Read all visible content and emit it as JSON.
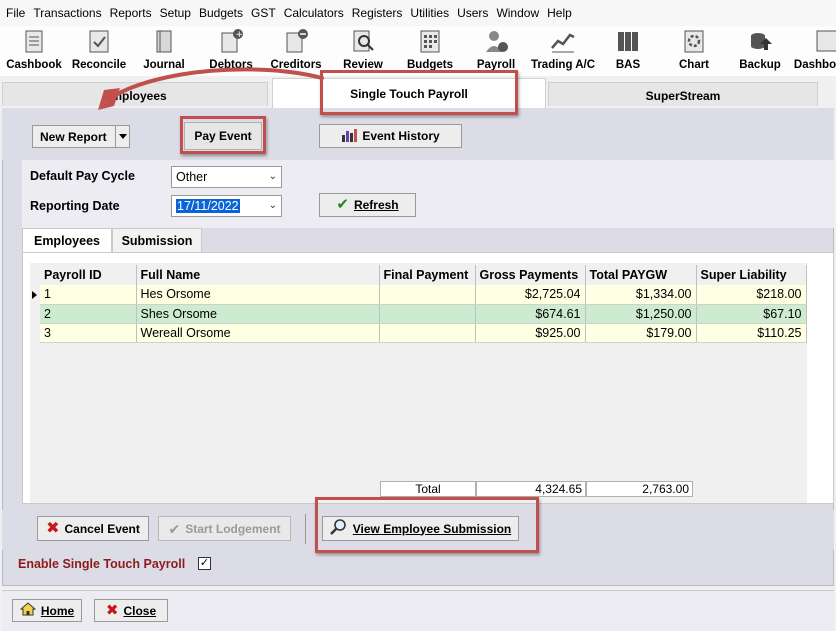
{
  "menu": [
    "File",
    "Transactions",
    "Reports",
    "Setup",
    "Budgets",
    "GST",
    "Calculators",
    "Registers",
    "Utilities",
    "Users",
    "Window",
    "Help"
  ],
  "toolbar": [
    {
      "label": "Cashbook",
      "icon": "cashbook-icon"
    },
    {
      "label": "Reconcile",
      "icon": "reconcile-icon"
    },
    {
      "label": "Journal",
      "icon": "journal-icon"
    },
    {
      "label": "Debtors",
      "icon": "debtors-icon"
    },
    {
      "label": "Creditors",
      "icon": "creditors-icon"
    },
    {
      "label": "Review",
      "icon": "review-icon"
    },
    {
      "label": "Budgets",
      "icon": "budgets-icon"
    },
    {
      "label": "Payroll",
      "icon": "payroll-icon"
    },
    {
      "label": "Trading A/C",
      "icon": "trading-icon"
    },
    {
      "label": "BAS",
      "icon": "bas-icon"
    },
    {
      "label": "Chart",
      "icon": "chart-icon"
    },
    {
      "label": "Backup",
      "icon": "backup-icon"
    },
    {
      "label": "Dashbo",
      "icon": "dashboard-icon"
    }
  ],
  "top_tabs": [
    {
      "label": "Employees"
    },
    {
      "label": "Single Touch Payroll"
    },
    {
      "label": "SuperStream"
    }
  ],
  "actions": {
    "new_report": "New Report",
    "pay_event": "Pay Event",
    "event_history": "Event History"
  },
  "form": {
    "pay_cycle_label": "Default Pay Cycle",
    "pay_cycle_value": "Other",
    "reporting_date_label": "Reporting Date",
    "reporting_date_value": "17/11/2022",
    "refresh": "Refresh"
  },
  "inner_tabs": [
    "Employees",
    "Submission"
  ],
  "grid": {
    "columns": [
      "Payroll ID",
      "Full Name",
      "Final Payment",
      "Gross Payments",
      "Total PAYGW",
      "Super Liability"
    ],
    "rows": [
      {
        "id": "1",
        "name": "Hes Orsome",
        "final": "",
        "gross": "$2,725.04",
        "paygw": "$1,334.00",
        "super": "$218.00"
      },
      {
        "id": "2",
        "name": "Shes Orsome",
        "final": "",
        "gross": "$674.61",
        "paygw": "$1,250.00",
        "super": "$67.10"
      },
      {
        "id": "3",
        "name": "Wereall Orsome",
        "final": "",
        "gross": "$925.00",
        "paygw": "$179.00",
        "super": "$110.25"
      }
    ],
    "total_label": "Total",
    "total_gross": "4,324.65",
    "total_paygw": "2,763.00"
  },
  "bottom": {
    "cancel_event": "Cancel Event",
    "start_lodgement": "Start Lodgement",
    "view_submission": "View Employee Submission",
    "enable_stp": "Enable Single Touch Payroll",
    "enable_checked": "✓"
  },
  "footer": {
    "home": "Home",
    "close": "Close"
  },
  "colors": {
    "annotation": "#c0504d",
    "row_yellow": "#ffffe4",
    "row_green": "#cdeccf",
    "enable_text": "#8b1c1c"
  }
}
